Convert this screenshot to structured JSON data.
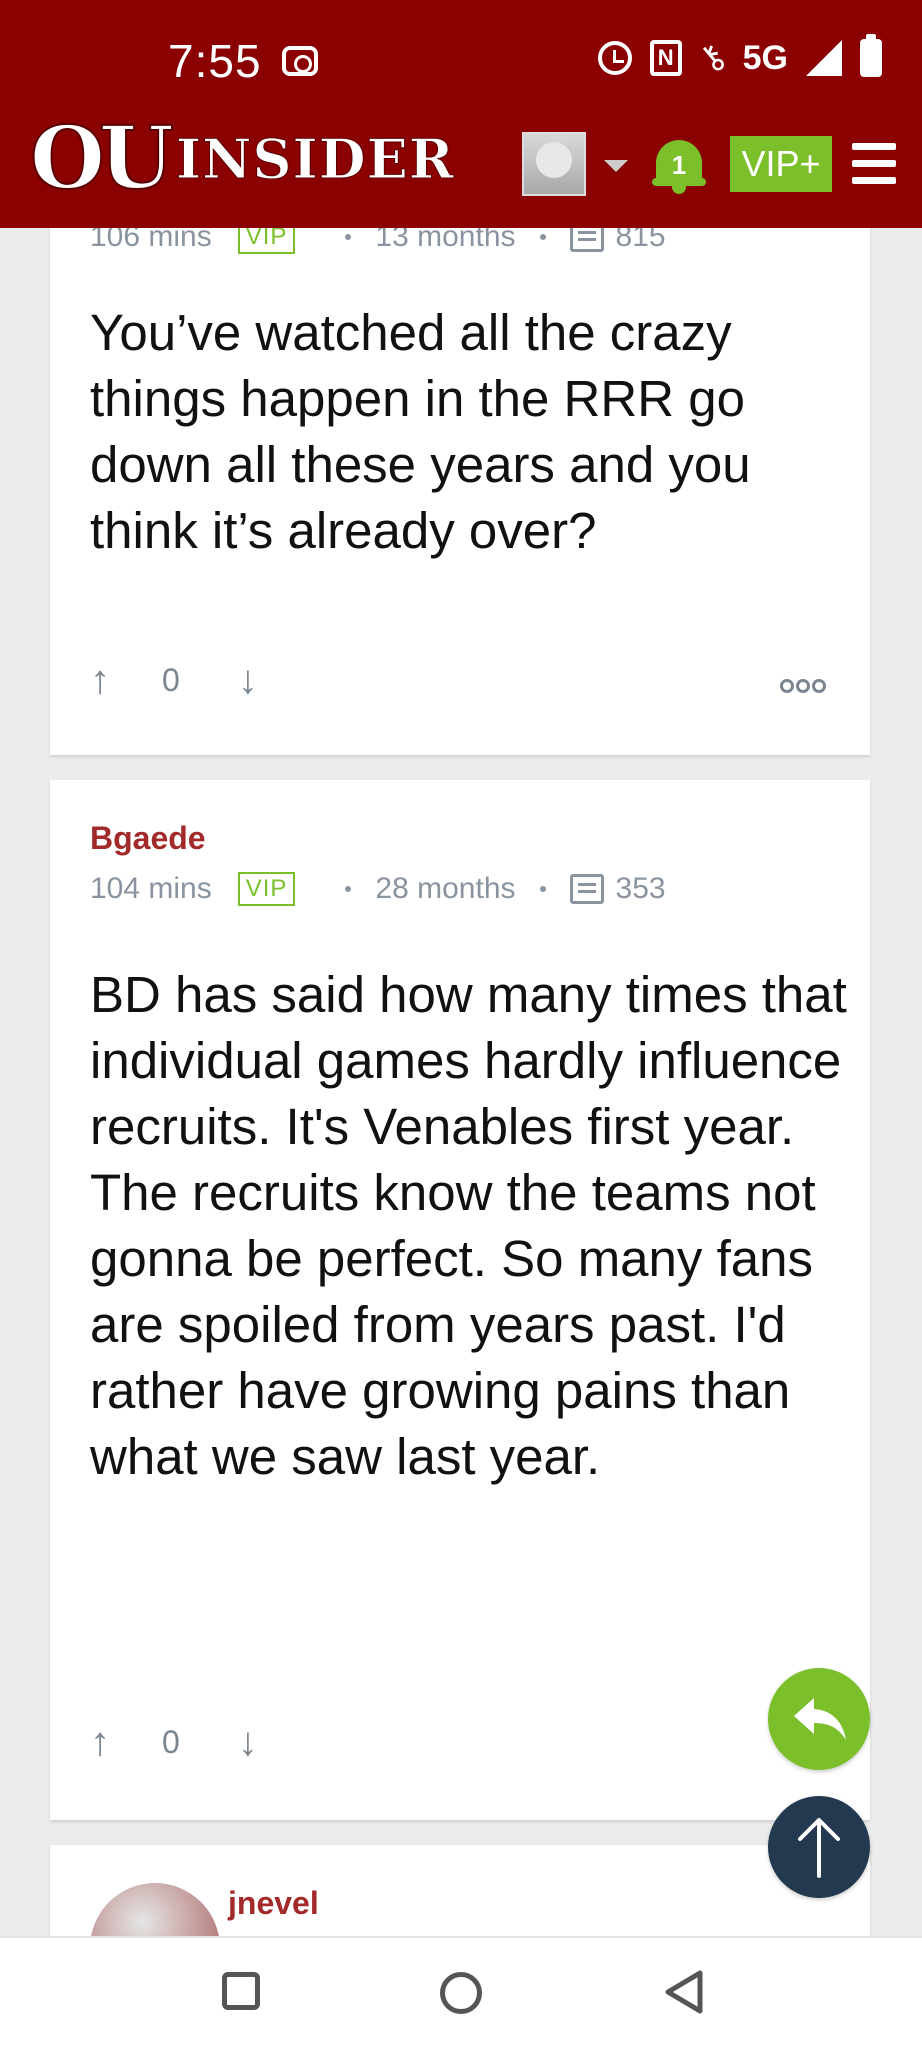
{
  "status_bar": {
    "time": "7:55",
    "network": "5G"
  },
  "header": {
    "logo_primary": "OU",
    "logo_secondary": "INSIDER",
    "notification_count": "1",
    "vip_label": "VIP+"
  },
  "comments": [
    {
      "username": "",
      "time": "106 mins",
      "badge": "VIP",
      "tenure": "13 months",
      "post_count": "815",
      "text": "You’ve watched all the crazy things happen in the RRR go down all these years and you think it’s already over?",
      "votes": "0"
    },
    {
      "username": "Bgaede",
      "time": "104 mins",
      "badge": "VIP",
      "tenure": "28 months",
      "post_count": "353",
      "text": "BD has said how many times that individual games hardly influence recruits. It's Venables first year. The recruits know the teams not gonna be perfect. So many fans are spoiled from years past. I'd rather have growing pains than what we saw last year.",
      "votes": "0"
    },
    {
      "username": "jnevel"
    }
  ],
  "colors": {
    "header_bg": "#8b0000",
    "accent_green": "#7bbf2a",
    "username_red": "#a32a2a",
    "fab_dark": "#23394f"
  },
  "icons": {
    "vote_up": "↑",
    "vote_down": "↓"
  }
}
